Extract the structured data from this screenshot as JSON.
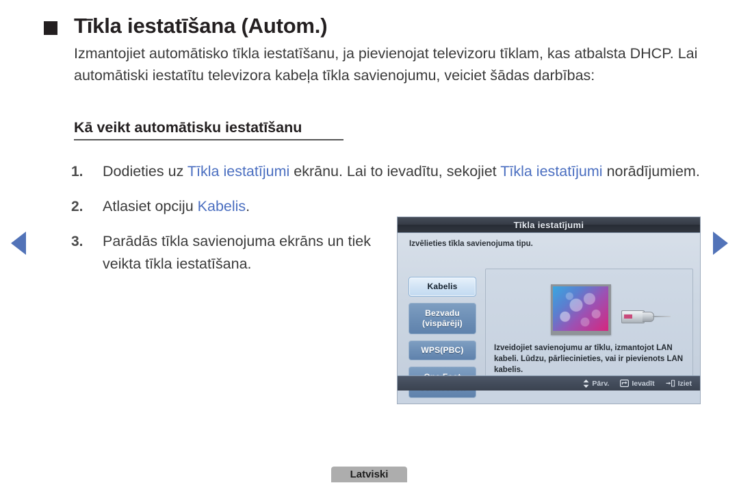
{
  "page": {
    "title": "Tīkla iestatīšana (Autom.)",
    "intro": "Izmantojiet automātisko tīkla iestatīšanu, ja pievienojat televizoru tīklam, kas atbalsta DHCP. Lai automātiski iestatītu televizora kabeļa tīkla savienojumu, veiciet šādas darbības:",
    "subheading": "Kā veikt automātisku iestatīšanu"
  },
  "steps": {
    "one": {
      "number": "1.",
      "part1": "Dodieties uz ",
      "link1": "Tīkla iestatījumi",
      "part2": " ekrānu. Lai to ievadītu, sekojiet ",
      "link2": "Tīkla iestatījumi",
      "part3": " norādījumiem."
    },
    "two": {
      "number": "2.",
      "part1": "Atlasiet opciju ",
      "link1": "Kabelis",
      "part2": "."
    },
    "three": {
      "number": "3.",
      "text": "Parādās tīkla savienojuma ekrāns un tiek veikta tīkla iestatīšana."
    }
  },
  "osd": {
    "title": "Tīkla iestatījumi",
    "instruction": "Izvēlieties tīkla savienojuma tipu.",
    "buttons": [
      {
        "label": "Kabelis",
        "state": "selected"
      },
      {
        "label": "Bezvadu (vispārēji)",
        "state": "normal"
      },
      {
        "label": "WPS(PBC)",
        "state": "normal"
      },
      {
        "label": "One Foot Connection",
        "state": "normal"
      }
    ],
    "description": "Izveidojiet savienojumu ar tīklu, izmantojot LAN kabeli. Lūdzu, pārliecinieties, vai ir pievienots LAN kabelis.",
    "footer": [
      {
        "icon": "up-down-arrow-icon",
        "label": "Pārv."
      },
      {
        "icon": "enter-icon",
        "label": "Ievadīt"
      },
      {
        "icon": "exit-icon",
        "label": "Iziet"
      }
    ]
  },
  "nav": {
    "prev": "previous-page-arrow",
    "next": "next-page-arrow"
  },
  "language_badge": "Latviski",
  "colors": {
    "link": "#4a6ec0",
    "nav_arrow": "#5273b8",
    "osd_title_bar": "#2f353f",
    "osd_footer": "#434c5b",
    "badge": "#adadad"
  }
}
